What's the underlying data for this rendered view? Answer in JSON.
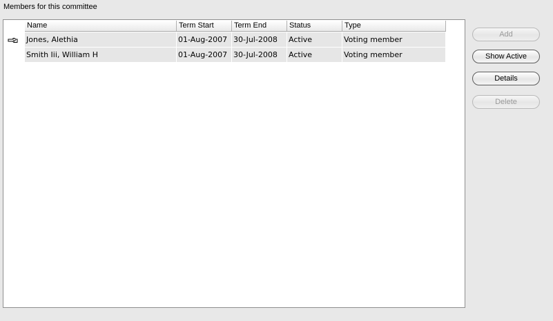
{
  "section_label": "Members for this committee",
  "table": {
    "columns": [
      "Name",
      "Term Start",
      "Term End",
      "Status",
      "Type"
    ],
    "rows": [
      {
        "name": "Jones, Alethia",
        "term_start": "01-Aug-2007",
        "term_end": "30-Jul-2008",
        "status": "Active",
        "type": "Voting member"
      },
      {
        "name": "Smith Iii, William H",
        "term_start": "01-Aug-2007",
        "term_end": "30-Jul-2008",
        "status": "Active",
        "type": "Voting member"
      }
    ],
    "selected_row_indicator": "pointing-hand-icon"
  },
  "buttons": {
    "add": {
      "label": "Add",
      "enabled": false
    },
    "show_active": {
      "label": "Show Active",
      "enabled": true
    },
    "details": {
      "label": "Details",
      "enabled": true
    },
    "delete": {
      "label": "Delete",
      "enabled": false
    }
  }
}
